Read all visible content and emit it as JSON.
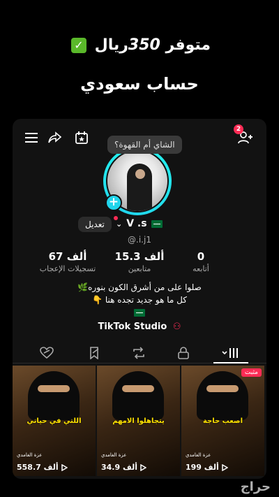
{
  "headline": {
    "line1_prefix": "متوفر",
    "line1_amount": "350",
    "line1_suffix": "ريال",
    "line2": "حساب سعودي"
  },
  "profile": {
    "tooltip": "الشاي أم القهوة؟",
    "edit_label": "تعديل",
    "display_name": "V .s",
    "username": "@.i.j1",
    "notification_count": "2",
    "stats": [
      {
        "num": "67 ألف",
        "label": "تسجيلات الإعجاب"
      },
      {
        "num": "15.3 ألف",
        "label": "متابعين"
      },
      {
        "num": "0",
        "label": "أتابعه"
      }
    ],
    "bio_line1": "صلوا على من أشرق الكون بنوره🌿",
    "bio_line2": "كل ما هو جديد تجده هنا 👇",
    "studio_label": "TikTok Studio"
  },
  "videos": [
    {
      "caption": "اللتي في حياتي",
      "tag": "عزة الغامدي",
      "views": "558.7 ألف",
      "pinned": ""
    },
    {
      "caption": "يتجاهلوا الامهم",
      "tag": "عزة الغامدي",
      "views": "34.9 ألف",
      "pinned": ""
    },
    {
      "caption": "اصعب حاجة",
      "tag": "عزة الغامدي",
      "views": "199 ألف",
      "pinned": "مثبت"
    }
  ],
  "watermark": "حراج",
  "colors": {
    "accent": "#fe2c55",
    "ring": "#20d5ec",
    "caption": "#ffe200"
  }
}
